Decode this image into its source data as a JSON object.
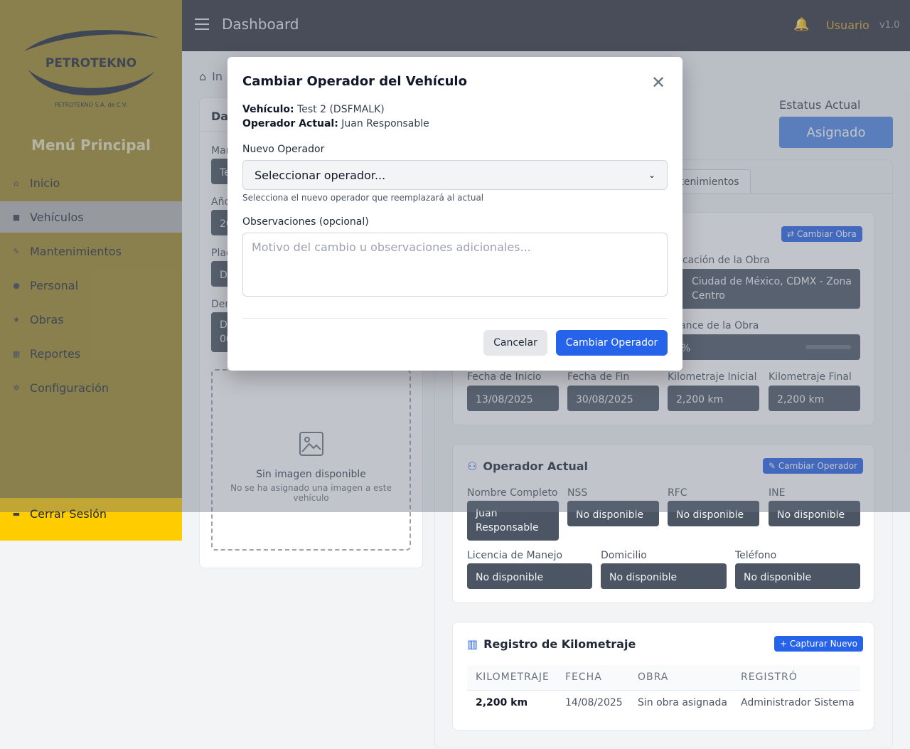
{
  "sidebar": {
    "logo_text": "PETROTEKNO",
    "logo_subtext": "PETROTEKNO S.A. de C.V.",
    "menu_title": "Menú Principal",
    "items": [
      {
        "label": "Inicio",
        "icon": "home-icon"
      },
      {
        "label": "Vehículos",
        "icon": "car-icon"
      },
      {
        "label": "Mantenimientos",
        "icon": "wrench-icon"
      },
      {
        "label": "Personal",
        "icon": "user-icon"
      },
      {
        "label": "Obras",
        "icon": "star-icon"
      },
      {
        "label": "Reportes",
        "icon": "chart-icon"
      },
      {
        "label": "Configuración",
        "icon": "gear-icon"
      }
    ],
    "logout": "Cerrar Sesión"
  },
  "topbar": {
    "title": "Dashboard",
    "user": "Usuario",
    "version": "v1.0"
  },
  "breadcrumb": {
    "home": "In"
  },
  "left_panel": {
    "title_partial": "Dat",
    "labels": [
      "Mar",
      "Año",
      "Plac",
      "Den"
    ],
    "values": [
      "Te",
      "20",
      "D",
      "D",
      "00"
    ],
    "image_title": "Sin imagen disponible",
    "image_subtitle": "No se ha asignado una imagen a este vehículo"
  },
  "status": {
    "label": "Estatus Actual",
    "value": "Asignado"
  },
  "tab": {
    "label": "tenimientos"
  },
  "obra": {
    "change_button": "⇄ Cambiar Obra",
    "ubicacion_label": "icación de la Obra",
    "ubicacion_value": "Ciudad de México, CDMX - Zona Centro",
    "avance_label": "ance de la Obra",
    "avance_value": "%",
    "fecha_inicio_label": "Fecha de Inicio",
    "fecha_inicio": "13/08/2025",
    "fecha_fin_label": "Fecha de Fin",
    "fecha_fin": "30/08/2025",
    "km_inicial_label": "Kilometraje Inicial",
    "km_inicial": "2,200 km",
    "km_final_label": "Kilometraje Final",
    "km_final": "2,200 km"
  },
  "operador": {
    "title": "Operador Actual",
    "change_button": "Cambiar Operador",
    "nombre_label": "Nombre Completo",
    "nombre": "Juan Responsable",
    "nss_label": "NSS",
    "nss": "No disponible",
    "rfc_label": "RFC",
    "rfc": "No disponible",
    "ine_label": "INE",
    "ine": "No disponible",
    "licencia_label": "Licencia de Manejo",
    "licencia": "No disponible",
    "domicilio_label": "Domicilio",
    "domicilio": "No disponible",
    "telefono_label": "Teléfono",
    "telefono": "No disponible"
  },
  "kilometraje": {
    "title": "Registro de Kilometraje",
    "capture_button": "+ Capturar Nuevo",
    "headers": [
      "KILOMETRAJE",
      "FECHA",
      "OBRA",
      "REGISTRÓ"
    ],
    "rows": [
      [
        "2,200 km",
        "14/08/2025",
        "Sin obra asignada",
        "Administrador Sistema"
      ]
    ]
  },
  "modal": {
    "title": "Cambiar Operador del Vehículo",
    "vehiculo_label": "Vehículo:",
    "vehiculo_value": "Test 2 (DSFMALK)",
    "operador_label": "Operador Actual:",
    "operador_value": "Juan Responsable",
    "nuevo_label": "Nuevo Operador",
    "select_value": "Seleccionar operador...",
    "select_help": "Selecciona el nuevo operador que reemplazará al actual",
    "obs_label": "Observaciones (opcional)",
    "obs_placeholder": "Motivo del cambio u observaciones adicionales...",
    "cancel": "Cancelar",
    "confirm": "Cambiar Operador"
  },
  "colors": {
    "sidebar": "#a08b2a",
    "topbar": "#2f333d",
    "primary": "#2563eb",
    "accent": "#d4a72c"
  }
}
